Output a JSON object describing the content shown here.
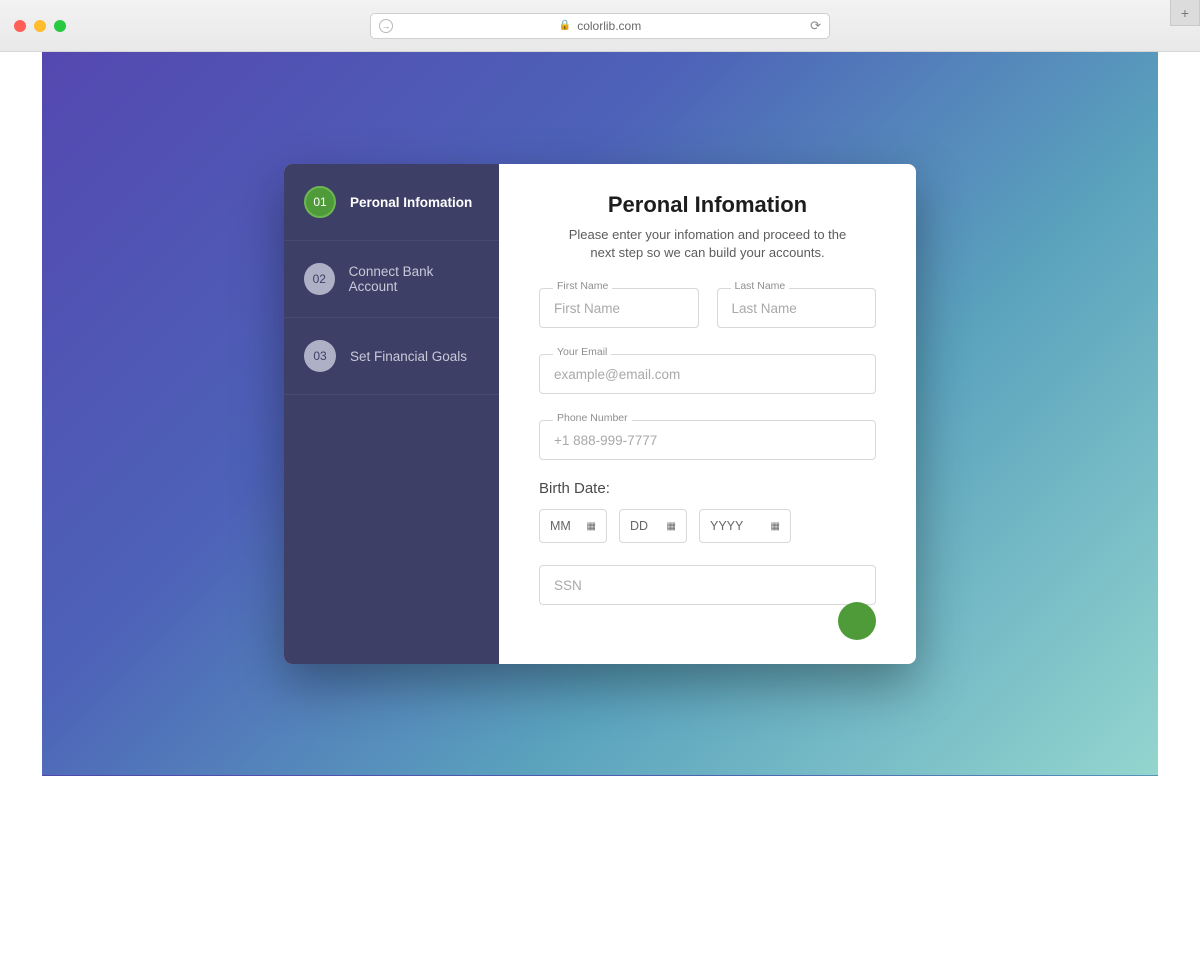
{
  "browser": {
    "url_host": "colorlib.com"
  },
  "sidebar": {
    "steps": [
      {
        "num": "01",
        "label": "Peronal Infomation",
        "active": true
      },
      {
        "num": "02",
        "label": "Connect Bank Account",
        "active": false
      },
      {
        "num": "03",
        "label": "Set Financial Goals",
        "active": false
      }
    ]
  },
  "form": {
    "title": "Peronal Infomation",
    "subtitle": "Please enter your infomation and proceed to the next step so we can build your accounts.",
    "first_name": {
      "label": "First Name",
      "placeholder": "First Name",
      "value": ""
    },
    "last_name": {
      "label": "Last Name",
      "placeholder": "Last Name",
      "value": ""
    },
    "email": {
      "label": "Your Email",
      "placeholder": "example@email.com",
      "value": ""
    },
    "phone": {
      "label": "Phone Number",
      "placeholder": "+1 888-999-7777",
      "value": ""
    },
    "birth_label": "Birth Date:",
    "birth_mm": {
      "placeholder": "MM"
    },
    "birth_dd": {
      "placeholder": "DD"
    },
    "birth_yyyy": {
      "placeholder": "YYYY"
    },
    "ssn": {
      "placeholder": "SSN",
      "value": ""
    }
  }
}
